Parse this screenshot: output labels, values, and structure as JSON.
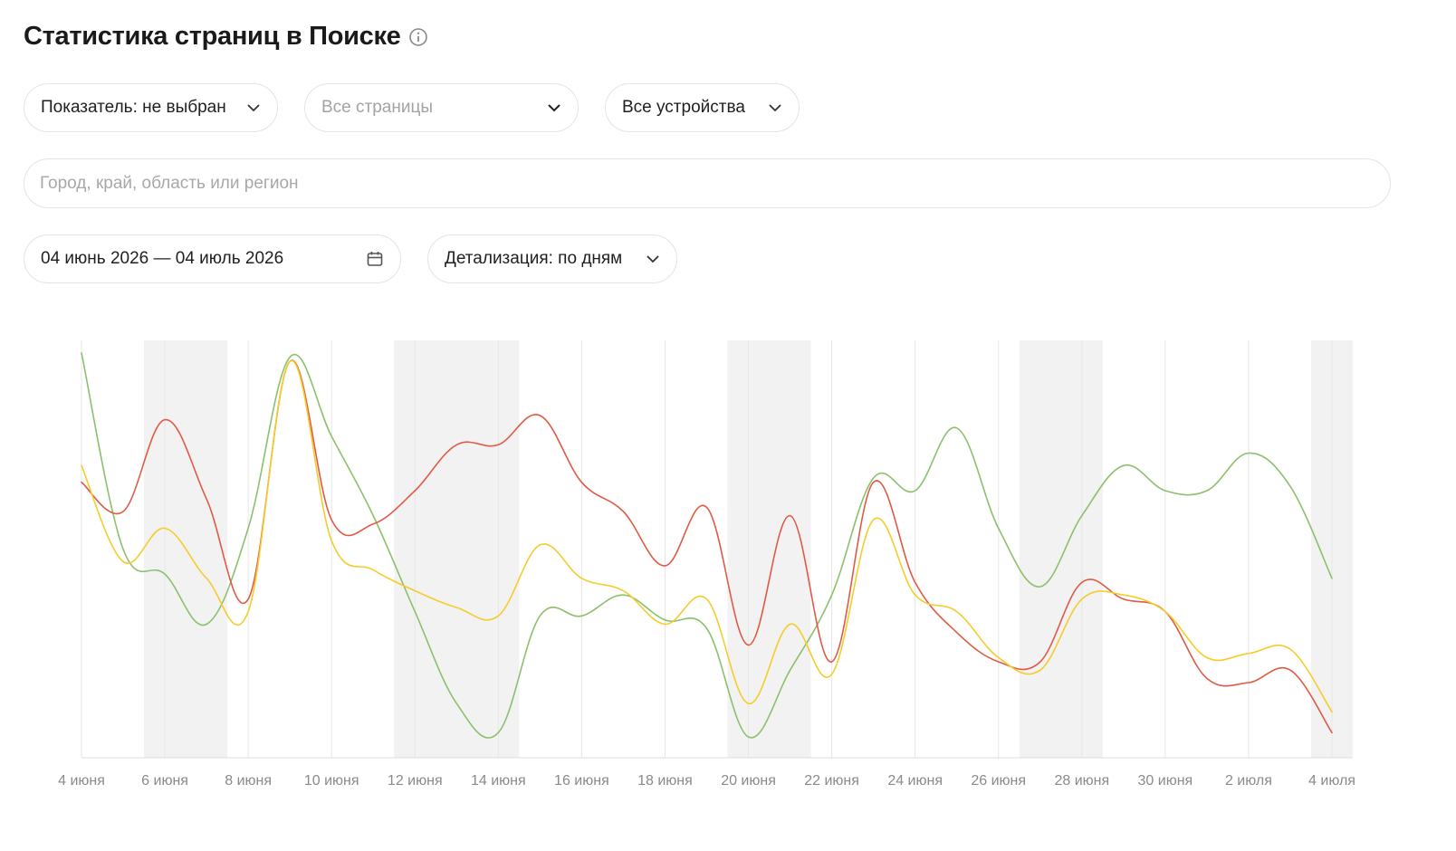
{
  "header": {
    "title": "Статистика страниц в Поиске",
    "info_icon": "info-icon"
  },
  "filters": {
    "metric_label": "Показатель: не выбран",
    "pages_placeholder": "Все страницы",
    "devices_label": "Все устройства",
    "region_placeholder": "Город, край, область или регион",
    "region_value": "",
    "date_range_label": "04 июнь 2026 — 04 июль 2026",
    "detail_label": "Детализация: по дням"
  },
  "icons": {
    "dropdown": "chevron-down-icon",
    "calendar": "calendar-icon",
    "info": "info-icon"
  },
  "colors": {
    "red_series": "#e05a45",
    "yellow_series": "#f5cc2a",
    "green_series": "#8cc06c",
    "weekend_band": "#f2f2f2",
    "grid": "#e6e6e6",
    "axis_label": "#8a8a8a"
  },
  "chart_data": {
    "type": "line",
    "x": [
      "4 июня",
      "5 июня",
      "6 июня",
      "7 июня",
      "8 июня",
      "9 июня",
      "10 июня",
      "11 июня",
      "12 июня",
      "13 июня",
      "14 июня",
      "15 июня",
      "16 июня",
      "17 июня",
      "18 июня",
      "19 июня",
      "20 июня",
      "21 июня",
      "22 июня",
      "23 июня",
      "24 июня",
      "25 июня",
      "26 июня",
      "27 июня",
      "28 июня",
      "29 июня",
      "30 июня",
      "1 июля",
      "2 июля",
      "3 июля",
      "4 июля"
    ],
    "tick_labels": [
      "4 июня",
      "6 июня",
      "8 июня",
      "10 июня",
      "12 июня",
      "14 июня",
      "16 июня",
      "18 июня",
      "20 июня",
      "22 июня",
      "24 июня",
      "26 июня",
      "28 июня",
      "30 июня",
      "2 июля",
      "4 июля"
    ],
    "weekends": [
      [
        "6 июня",
        "7 июня"
      ],
      [
        "12 июня",
        "14 июня"
      ],
      [
        "20 июня",
        "21 июня"
      ],
      [
        "27 июня",
        "28 июня"
      ],
      [
        "4 июля",
        "4 июля"
      ]
    ],
    "y_axis_visible": false,
    "grid": "vertical",
    "ylim": [
      0,
      100
    ],
    "series": [
      {
        "color": "#e05a45",
        "values": [
          66,
          59,
          81,
          62,
          38,
          95,
          57,
          56,
          64,
          75,
          75,
          82,
          66,
          59,
          46,
          60,
          27,
          58,
          23,
          66,
          42,
          30,
          23,
          23,
          42,
          38,
          35,
          19,
          18,
          21,
          6
        ]
      },
      {
        "color": "#f5cc2a",
        "values": [
          70,
          47,
          55,
          43,
          35,
          95,
          52,
          45,
          40,
          36,
          34,
          51,
          43,
          40,
          32,
          38,
          13,
          32,
          20,
          57,
          39,
          35,
          24,
          21,
          38,
          39,
          35,
          24,
          25,
          26,
          11
        ]
      },
      {
        "color": "#8cc06c",
        "values": [
          97,
          50,
          44,
          32,
          55,
          96,
          77,
          58,
          35,
          13,
          6,
          34,
          34,
          39,
          33,
          31,
          5,
          21,
          39,
          67,
          64,
          79,
          55,
          41,
          58,
          70,
          64,
          64,
          73,
          65,
          43
        ]
      }
    ]
  }
}
